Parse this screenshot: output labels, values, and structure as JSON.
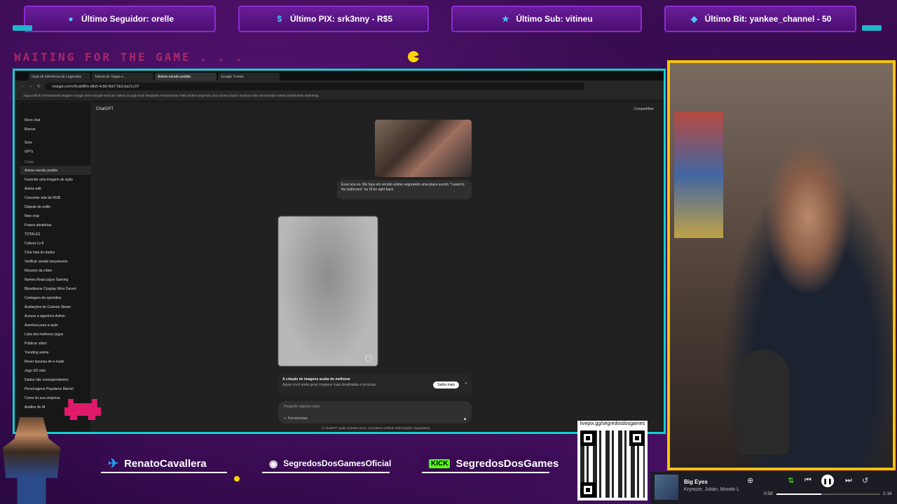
{
  "overlay": {
    "top_bars": [
      {
        "icon": "user-icon",
        "text": "Último Seguidor: orelle"
      },
      {
        "icon": "pix-icon",
        "text": "Último PIX: srk3nny - R$5"
      },
      {
        "icon": "star-icon",
        "text": "Último Sub: vitineu"
      },
      {
        "icon": "diamond-icon",
        "text": "Último Bit: yankee_channel - 50"
      }
    ],
    "waiting_text": "WAITING FOR THE GAME . . .",
    "socials": {
      "twitter": "RenatoCavallera",
      "instagram": "SegredosDosGamesOficial",
      "kick_badge": "KICK",
      "kick": "SegredosDosGames"
    },
    "qr_label": "livepix.gg/segredosdosgames",
    "accent_colors": {
      "frame": "#10d0d0",
      "webcam_border": "#f5c400",
      "kick": "#53fc18"
    }
  },
  "browser": {
    "tabs": [
      "Guia de Inferência de Legendas",
      "Tabela de Vagas e...",
      "Anime-versão pedido",
      "Google Trends"
    ],
    "url": "chatgpt.com/c/6cde8f0e-d8e5-4c8d-9bd7-5b2c6a21e1f7",
    "bookmarks": "Jogos  Infinito  Ferramentas  Imagem  Google Drive  Google Notícias  Videos  Google tools  Templates  Ferramentas  Trello  Notion  Segredos dos Games  Outros  Notícias  Adm  Gerenciador  Hacks  Dashboards  Marketing",
    "sidebar": {
      "top_items": [
        "Novo chat",
        "Buscar"
      ],
      "nav_items": [
        "Sora",
        "GPTs"
      ],
      "section": "Chats",
      "chats": [
        "Anime-versão pedido",
        "Fazendo uma imagem de ação",
        "Anime edit",
        "Converter arte de RGB",
        "Dispute de estilo",
        "New chat",
        "Frases aleatórias",
        "TOTALES",
        "Cultura Lo-fi",
        "Criar lista de dados",
        "Verificar versão lançamento",
        "Resumo da vídeo",
        "Nomes Reais jogos Gaming",
        "Bloodborne Cosplay Wins Desert",
        "Contagem de episódios",
        "Avaliações de Carteira Steam",
        "Acesso a algoritmo Admin",
        "Aventura para a ação",
        "Lista dos melhores jogos",
        "Publicar vídeo",
        "Trending anime",
        "Rever lacunas de e-mails",
        "Jogo SO vital",
        "Dados não correspondentes",
        "Personagens Populares Marvel",
        "Como ler sua empresa",
        "Análise de IA"
      ]
    },
    "chat": {
      "model": "ChatGPT",
      "share": "Compartilhar",
      "user_message": "Esse sou eu. Me faça em versão anime segurando uma placa escrito \"I want to the bathroom\" ou I'll be right back",
      "notice_title": "A criação de imagens acaba de melhorar",
      "notice_body": "Agora você pode gerar imagens mais detalhadas e precisas.",
      "notice_button": "Saiba mais",
      "composer_placeholder": "Pergunte alguma coisa",
      "composer_tool": "Ferramentas",
      "disclaimer": "O ChatGPT pode cometer erros. Considere verificar informações importantes."
    }
  },
  "music": {
    "title": "Big Eyes",
    "artist": "Krynoze, Julián, Mondo L",
    "elapsed": "0:58",
    "duration": "2:16",
    "progress": 0.43
  }
}
